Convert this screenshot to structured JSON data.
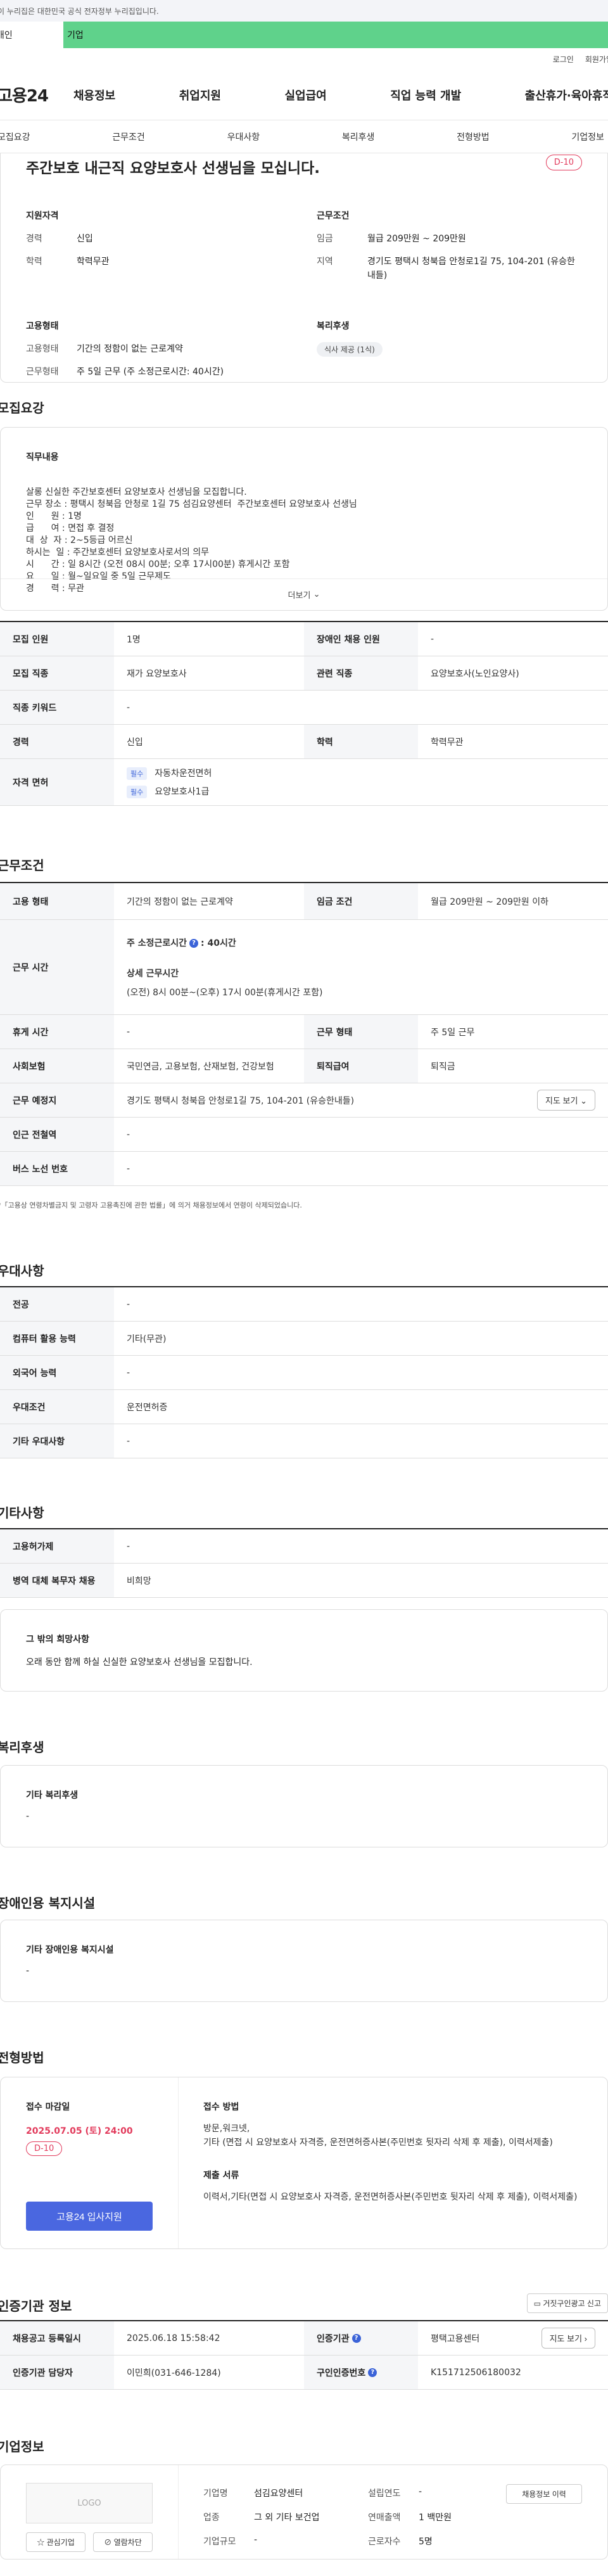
{
  "banner": {
    "text": "이 누리집은 대한민국 공식 전자정부 누리집입니다."
  },
  "tabs": {
    "personal": "개인",
    "company": "기업"
  },
  "util": {
    "login": "로그인",
    "join": "회원가입"
  },
  "gnb": {
    "logo": "고용24",
    "items": [
      "채용정보",
      "취업지원",
      "실업급여",
      "직업 능력 개발",
      "출산휴가·육아휴직"
    ]
  },
  "anchor": [
    "모집요강",
    "근무조건",
    "우대사항",
    "복리후생",
    "전형방법",
    "기업정보"
  ],
  "summary": {
    "title": "주간보호 내근직 요양보호사 선생님을 모십니다.",
    "dday": "D-10",
    "qual": {
      "head": "지원자격",
      "career_k": "경력",
      "career_v": "신입",
      "edu_k": "학력",
      "edu_v": "학력무관"
    },
    "cond": {
      "head": "근무조건",
      "wage_k": "임금",
      "wage_v": "월급 209만원 ~ 209만원",
      "area_k": "지역",
      "area_v": "경기도 평택시 청북읍 안청로1길 75, 104-201 (유승한내들)"
    },
    "emp": {
      "head": "고용형태",
      "type_k": "고용형태",
      "type_v": "기간의 정함이 없는 근로계약",
      "form_k": "근무형태",
      "form_v": "주 5일 근무 (주 소정근로시간: 40시간)"
    },
    "welfare": {
      "head": "복리후생",
      "chip": "식사 제공 (1식)"
    }
  },
  "recruit": {
    "section": "모집요강",
    "content_head": "직무내용",
    "lines": [
      "살롱 신실한 주간보호센터 요양보호사 선생님을 모집합니다.",
      "근무 장소 : 평택시 청북읍 안청로 1길 75 섬김요양센터  주간보호센터 요양보호사 선생님",
      "인      원 : 1명",
      "급      여 : 면접 후 결정",
      "대  상  자 : 2~5등급 어르신",
      "하시는  일 : 주간보호센터 요양보호사로서의 의무",
      "시      간 : 일 8시간 (오전 08시 00분; 오후 17시00분) 휴게시간 포함",
      "요      일 : 월~일요일 중 5일 근무제도",
      "경      력 : 무관"
    ],
    "more": "더보기",
    "rows": [
      {
        "k1": "모집 인원",
        "v1": "1명",
        "k2": "장애인 채용 인원",
        "v2": "-"
      },
      {
        "k1": "모집 직종",
        "v1": "재가 요양보호사",
        "k2": "관련 직종",
        "v2": "요양보호사(노인요양사)"
      },
      {
        "k1": "직종 키워드",
        "v1": "-"
      },
      {
        "k1": "경력",
        "v1": "신입",
        "k2": "학력",
        "v2": "학력무관"
      }
    ],
    "license_k": "자격 면허",
    "license_badge": "필수",
    "licenses": [
      "자동차운전면허",
      "요양보호사1급"
    ]
  },
  "work": {
    "section": "근무조건",
    "type_k": "고용 형태",
    "type_v": "기간의 정함이 없는 근로계약",
    "wage_k": "임금 조건",
    "wage_v": "월급 209만원 ~ 209만원 이하",
    "hours_k": "근무 시간",
    "weekly": "주 소정근로시간",
    "weekly_v": ": 40시간",
    "detail_h": "상세 근무시간",
    "detail_v": "(오전) 8시 00분~(오후) 17시 00분(휴게시간 포함)",
    "rest_k": "휴게 시간",
    "rest_v": "-",
    "form_k": "근무 형태",
    "form_v": "주 5일 근무",
    "ins_k": "사회보험",
    "ins_v": "국민연금, 고용보험, 산재보험, 건강보험",
    "ret_k": "퇴직급여",
    "ret_v": "퇴직금",
    "place_k": "근무 예정지",
    "place_v": "경기도 평택시 청북읍 안청로1길 75, 104-201 (유승한내들)",
    "map": "지도 보기",
    "subway_k": "인근 전철역",
    "subway_v": "-",
    "bus_k": "버스 노선 번호",
    "bus_v": "-",
    "note": "*「고용상 연령차별금지 및 고령자 고용촉진에 관한 법률」에 의거 채용정보에서 연령이 삭제되었습니다."
  },
  "pref": {
    "section": "우대사항",
    "rows": [
      {
        "k": "전공",
        "v": "-"
      },
      {
        "k": "컴퓨터 활용 능력",
        "v": "기타(무관)"
      },
      {
        "k": "외국어 능력",
        "v": "-"
      },
      {
        "k": "우대조건",
        "v": "운전면허증"
      },
      {
        "k": "기타 우대사항",
        "v": "-"
      }
    ]
  },
  "etc": {
    "section": "기타사항",
    "rows": [
      {
        "k": "고용허가제",
        "v": "-"
      },
      {
        "k": "병역 대체 복무자 채용",
        "v": "비희망"
      }
    ],
    "wish_h": "그 밖의 희망사항",
    "wish_v": "오래 동안 함께 하실 신실한 요양보호사 선생님을 모집합니다."
  },
  "benefit": {
    "section": "복리후생",
    "head": "기타 복리후생",
    "value": "-"
  },
  "disab": {
    "section": "장애인용 복지시설",
    "head": "기타 장애인용 복지시설",
    "value": "-"
  },
  "screen": {
    "section": "전형방법",
    "deadline_h": "접수 마감일",
    "deadline_v": "2025.07.05 (토) 24:00",
    "dday": "D-10",
    "apply": "고용24 입사지원",
    "method_h": "접수 방법",
    "method_v": "방문,워크넷,\n기타 (면접 시 요양보호사 자격증, 운전면허증사본(주민번호 뒷자리 삭제 후 제출), 이력서제출)",
    "docs_h": "제출 서류",
    "docs_v": "이력서,기타(면접 시 요양보호사 자격증, 운전면허증사본(주민번호 뒷자리 삭제 후 제출), 이력서제출)"
  },
  "cert": {
    "section": "인증기관 정보",
    "report": "거짓구인광고 신고",
    "reg_k": "채용공고 등록일시",
    "reg_v": "2025.06.18 15:58:42",
    "org_k": "인증기관",
    "org_v": "평택고용센터",
    "map": "지도 보기",
    "mgr_k": "인증기관 담당자",
    "mgr_v": "이민희(031-646-1284)",
    "no_k": "구인인증번호",
    "no_v": "K151712506180032"
  },
  "company": {
    "section": "기업정보",
    "logo": "LOGO",
    "fav": "관심기업",
    "block": "열람차단",
    "history": "채용정보 이력",
    "name_k": "기업명",
    "name_v": "섬김요양센터",
    "year_k": "설립연도",
    "year_v": "-",
    "ind_k": "업종",
    "ind_v": "그 외 기타 보건업",
    "sales_k": "연매출액",
    "sales_v": "1 백만원",
    "size_k": "기업규모",
    "size_v": "-",
    "emp_k": "근로자수",
    "emp_v": "5명"
  }
}
